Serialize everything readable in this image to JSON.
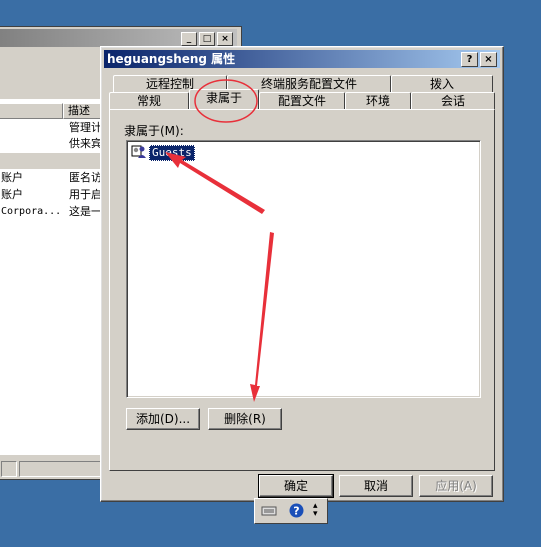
{
  "dialog": {
    "title": "heguangsheng 属性",
    "help_label": "?",
    "close_label": "×",
    "tabs_row1": [
      "远程控制",
      "终端服务配置文件",
      "拨入"
    ],
    "tabs_row2": [
      "常规",
      "隶属于",
      "配置文件",
      "环境",
      "会话"
    ],
    "active_tab": "隶属于",
    "member_of_label": "隶属于(M):",
    "members": [
      "Guests"
    ],
    "add_button": "添加(D)...",
    "remove_button": "删除(R)",
    "ok_button": "确定",
    "cancel_button": "取消",
    "apply_button": "应用(A)"
  },
  "background_window": {
    "column_header": "描述",
    "rows": [
      {
        "name": "",
        "desc": "管理计"
      },
      {
        "name": "",
        "desc": "供来宾"
      },
      {
        "name": "账户",
        "desc": "匿名访"
      },
      {
        "name": "账户",
        "desc": "用于启"
      },
      {
        "name": "Corpora...",
        "desc": "这是一"
      }
    ]
  },
  "colors": {
    "desktop": "#3a6ea5",
    "title_active": "#0a246a",
    "annotation_red": "#e8303a"
  }
}
